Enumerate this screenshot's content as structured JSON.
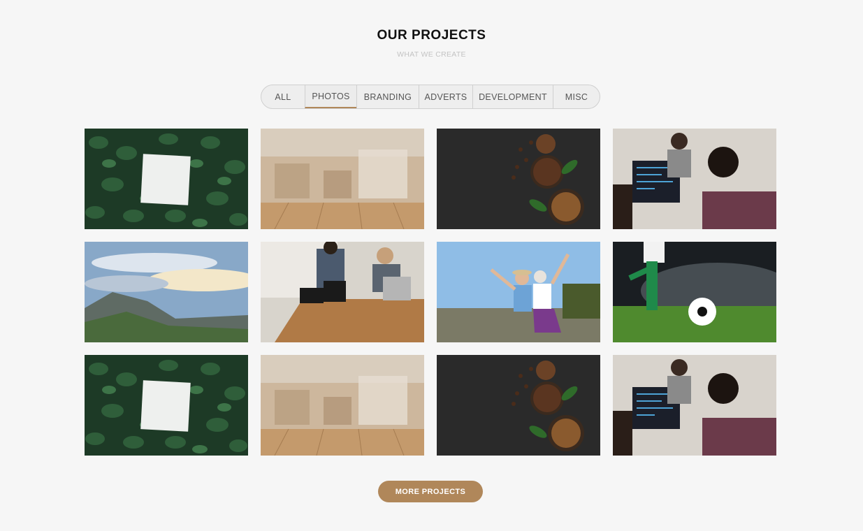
{
  "header": {
    "title": "OUR PROJECTS",
    "subtitle": "WHAT WE CREATE"
  },
  "filters": {
    "items": [
      "ALL",
      "PHOTOS",
      "BRANDING",
      "ADVERTS",
      "DEVELOPMENT",
      "MISC"
    ],
    "active": "PHOTOS"
  },
  "gallery": {
    "items": [
      {
        "subject": "leaves-card-photo"
      },
      {
        "subject": "wood-table-photo"
      },
      {
        "subject": "coffee-beans-photo"
      },
      {
        "subject": "developers-photo"
      },
      {
        "subject": "mountain-sky-photo"
      },
      {
        "subject": "meeting-photo"
      },
      {
        "subject": "seniors-selfie-photo"
      },
      {
        "subject": "soccer-photo"
      },
      {
        "subject": "leaves-card-photo"
      },
      {
        "subject": "wood-table-photo"
      },
      {
        "subject": "coffee-beans-photo"
      },
      {
        "subject": "developers-photo"
      }
    ]
  },
  "more_button": {
    "label": "MORE PROJECTS"
  },
  "colors": {
    "accent": "#b0875a",
    "background": "#f6f6f6"
  }
}
